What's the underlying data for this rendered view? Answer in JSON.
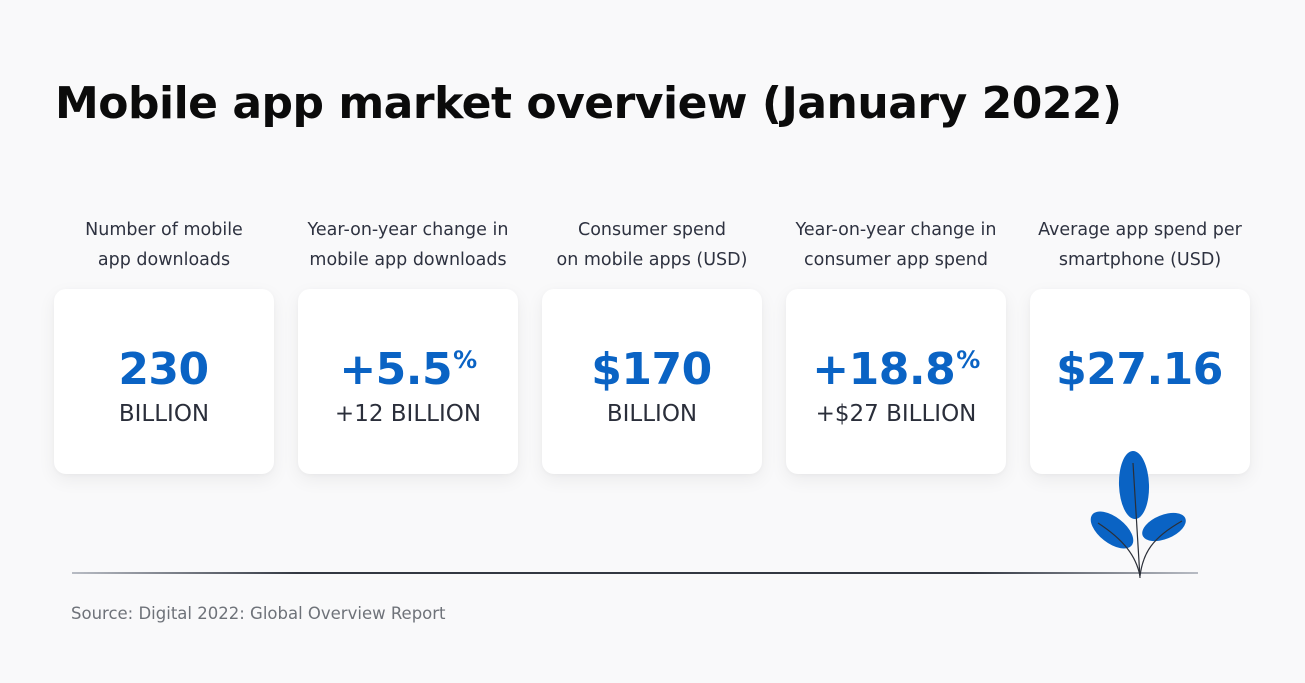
{
  "title": "Mobile app market overview (January 2022)",
  "accent_color": "#0a63c4",
  "metrics": [
    {
      "label_line1": "Number of mobile",
      "label_line2": "app downloads",
      "value": "230",
      "value_suffix": "",
      "sub": "BILLION"
    },
    {
      "label_line1": "Year-on-year change in",
      "label_line2": "mobile app downloads",
      "value": "+5.5",
      "value_suffix": "%",
      "sub": "+12 BILLION"
    },
    {
      "label_line1": "Consumer spend",
      "label_line2": "on mobile apps (USD)",
      "value": "$170",
      "value_suffix": "",
      "sub": "BILLION"
    },
    {
      "label_line1": "Year-on-year change in",
      "label_line2": "consumer app spend",
      "value": "+18.8",
      "value_suffix": "%",
      "sub": "+$27 BILLION"
    },
    {
      "label_line1": "Average app spend per",
      "label_line2": "smartphone (USD)",
      "value": "$27.16",
      "value_suffix": "",
      "sub": ""
    }
  ],
  "decoration": {
    "icon": "plant-icon"
  },
  "source": "Source: Digital 2022: Global Overview Report"
}
